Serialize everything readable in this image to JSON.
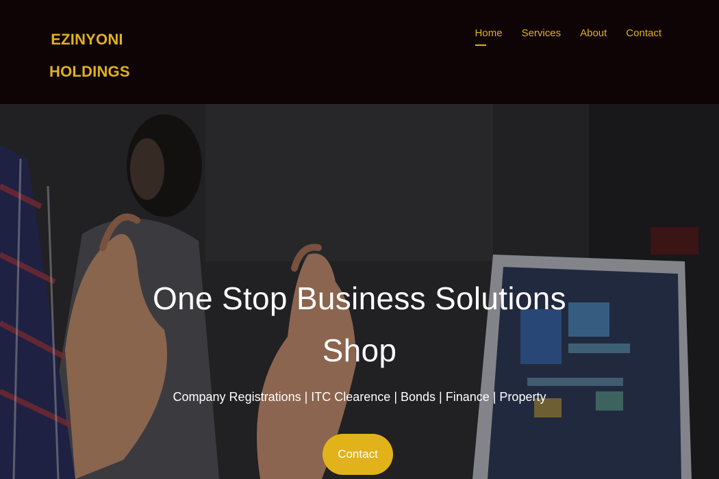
{
  "brand": {
    "line1": "EZINYONI",
    "line2": "HOLDINGS"
  },
  "nav": {
    "items": [
      {
        "label": "Home",
        "active": true
      },
      {
        "label": "Services",
        "active": false
      },
      {
        "label": "About",
        "active": false
      },
      {
        "label": "Contact",
        "active": false
      }
    ]
  },
  "hero": {
    "title_line1": "One Stop Business Solutions",
    "title_line2": "Shop",
    "subtitle": "Company Registrations | ITC Clearence | Bonds | Finance | Property",
    "cta_label": "Contact"
  },
  "colors": {
    "accent": "#e2b21b",
    "header_bg": "#0e0305",
    "text_light": "#ffffff"
  }
}
